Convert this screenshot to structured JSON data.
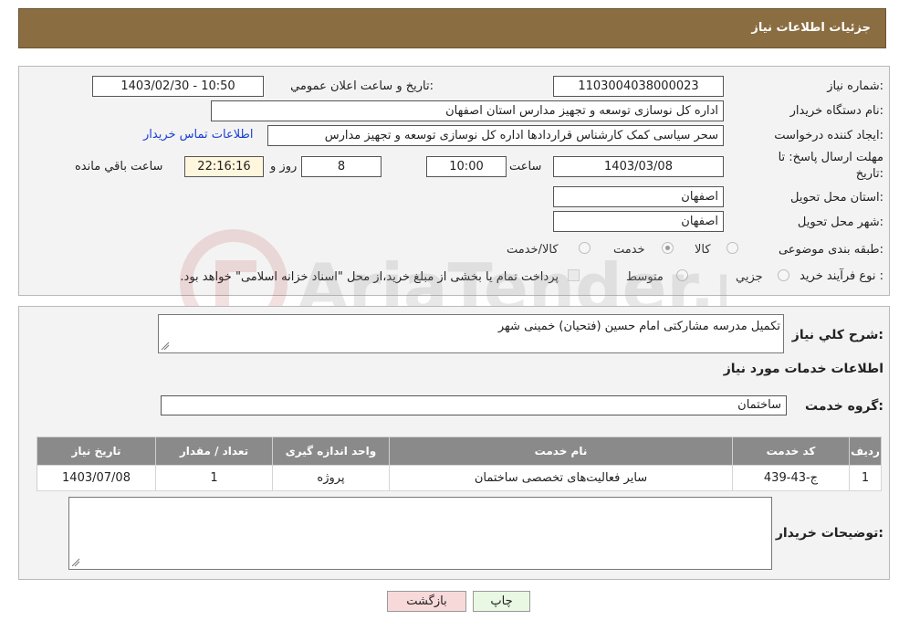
{
  "header": {
    "title": "جزئیات اطلاعات نیاز"
  },
  "form": {
    "need_number_label": "شماره نیاز:",
    "need_number": "1103004038000023",
    "announce_label": "تاریخ و ساعت اعلان عمومي:",
    "announce_value": "1403/02/30 - 10:50",
    "buyer_org_label": "نام دستگاه خريدار:",
    "buyer_org": "اداره کل نوسازی  توسعه و تجهیز مدارس استان اصفهان",
    "creator_label": "ایجاد کننده درخواست:",
    "creator": "سحر سیاسی کمک کارشناس قراردادها اداره کل نوسازی  توسعه و تجهیز مدارس",
    "contact_link": "اطلاعات تماس خریدار",
    "deadline_label_1": "مهلت ارسال پاسخ: تا",
    "deadline_label_2": "تاریخ:",
    "deadline_date": "1403/03/08",
    "time_label": "ساعت",
    "deadline_time": "10:00",
    "days_value": "8",
    "days_label": "روز و",
    "remaining_time": "22:16:16",
    "remaining_label": "ساعت باقي مانده",
    "province_label": "استان محل تحویل:",
    "province": "اصفهان",
    "city_label": "شهر محل تحویل:",
    "city": "اصفهان",
    "category_label": "طبقه بندی موضوعی:",
    "category_options": [
      "کالا",
      "خدمت",
      "کالا/خدمت"
    ],
    "category_selected": "خدمت",
    "process_label": "نوع فرآیند خرید :",
    "process_options": [
      "جزیي",
      "متوسط"
    ],
    "payment_note": "پرداخت تمام یا بخشی از مبلغ خرید،از محل \"اسناد خزانه اسلامی\" خواهد بود."
  },
  "summary": {
    "description_label": "شرح کلي نياز:",
    "description": "تکمیل مدرسه مشارکتی امام حسین (فتحیان) خمینی شهر",
    "services_title": "اطلاعات خدمات مورد نياز",
    "service_group_label": "گروه خدمت:",
    "service_group": "ساختمان"
  },
  "table": {
    "headers": [
      "رديف",
      "کد خدمت",
      "نام خدمت",
      "واحد اندازه گیری",
      "تعداد / مقدار",
      "تاریخ نیاز"
    ],
    "rows": [
      [
        "1",
        "ج-43-439",
        "سایر فعالیت‌های تخصصی ساختمان",
        "پروژه",
        "1",
        "1403/07/08"
      ]
    ]
  },
  "buyer_notes": {
    "label": "توضیحات خریدار:",
    "value": ""
  },
  "buttons": {
    "print": "چاپ",
    "back": "بازگشت"
  },
  "colors": {
    "title_bar": "#8b6d42",
    "table_header": "#8a8a8a",
    "link": "#1a3fd6",
    "back_button": "#f8d9d9",
    "print_button": "#e8f8e2"
  },
  "watermark": {
    "text": "AriaTender.net"
  }
}
